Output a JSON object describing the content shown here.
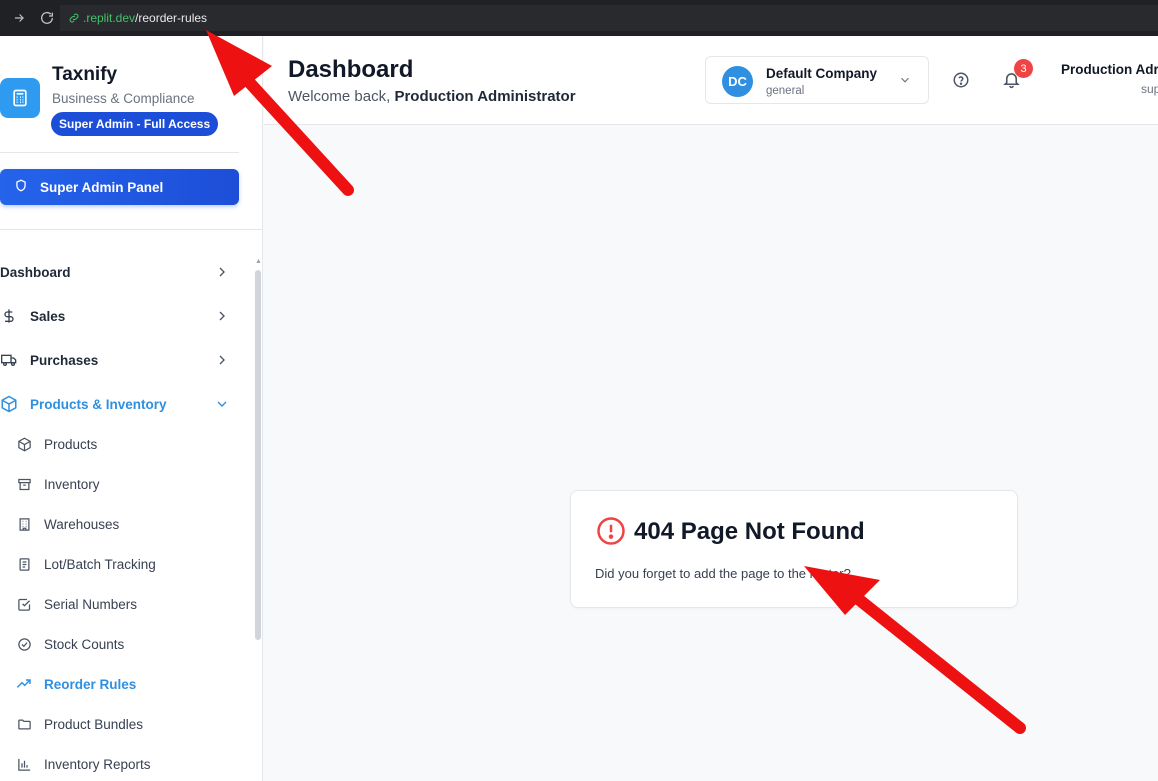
{
  "browser": {
    "url_domain": ".replit.dev",
    "url_path": "/reorder-rules"
  },
  "sidebar": {
    "brand_title": "Taxnify",
    "brand_subtitle": "Business & Compliance",
    "role_badge": "Super Admin - Full Access",
    "admin_button": "Super Admin Panel",
    "nav": [
      {
        "label": "Dashboard"
      },
      {
        "label": "Sales"
      },
      {
        "label": "Purchases"
      },
      {
        "label": "Products & Inventory"
      }
    ],
    "sub": [
      {
        "label": "Products"
      },
      {
        "label": "Inventory"
      },
      {
        "label": "Warehouses"
      },
      {
        "label": "Lot/Batch Tracking"
      },
      {
        "label": "Serial Numbers"
      },
      {
        "label": "Stock Counts"
      },
      {
        "label": "Reorder Rules"
      },
      {
        "label": "Product Bundles"
      },
      {
        "label": "Inventory Reports"
      }
    ]
  },
  "header": {
    "title": "Dashboard",
    "welcome_prefix": "Welcome back,",
    "welcome_name": "Production Administrator",
    "company_initials": "DC",
    "company_name": "Default Company",
    "company_type": "general",
    "notification_count": "3",
    "user_name": "Production Adr",
    "user_role": "sup"
  },
  "card": {
    "title": "404 Page Not Found",
    "message": "Did you forget to add the page to the router?"
  },
  "colors": {
    "accent": "#2f8fe0",
    "primary_button": "#2563eb",
    "error": "#ef4444",
    "annotation_arrow": "#ee1111"
  }
}
